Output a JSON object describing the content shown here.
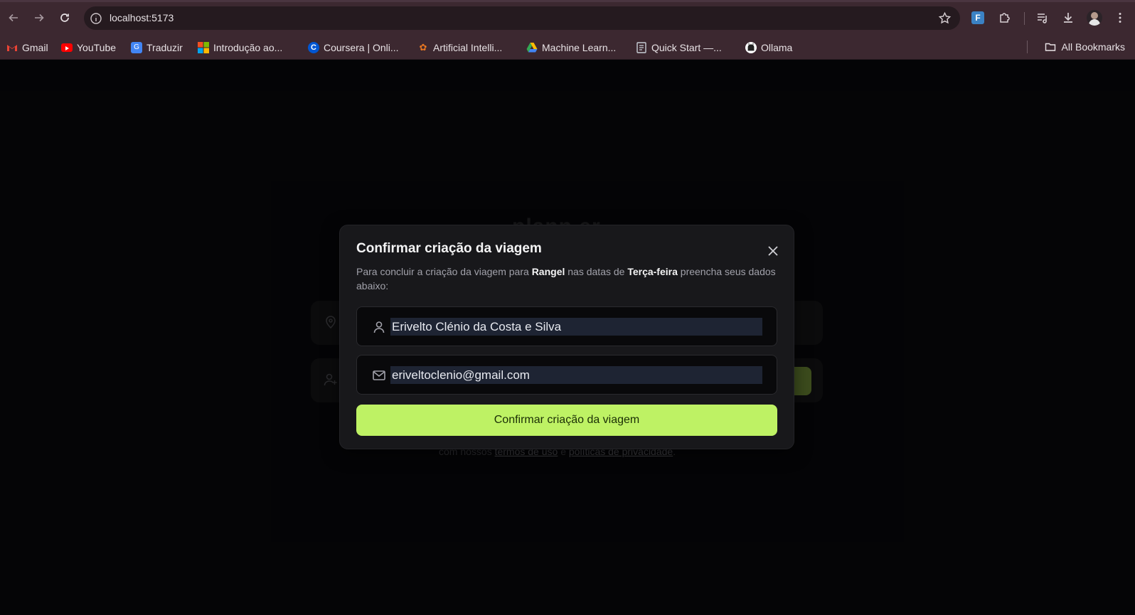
{
  "browser": {
    "url": "localhost:5173",
    "bookmarks": [
      {
        "label": "Gmail",
        "icon": "gmail-icon",
        "color": "#ea4335"
      },
      {
        "label": "YouTube",
        "icon": "youtube-icon",
        "color": "#ff0000"
      },
      {
        "label": "Traduzir",
        "icon": "google-translate-icon",
        "color": "#4285f4"
      },
      {
        "label": "Introdução ao...",
        "icon": "microsoft-icon",
        "color": "#f25022"
      },
      {
        "label": "Coursera | Onli...",
        "icon": "coursera-icon",
        "color": "#0056d2"
      },
      {
        "label": "Artificial Intelli...",
        "icon": "ai-course-icon",
        "color": "#e87722"
      },
      {
        "label": "Machine Learn...",
        "icon": "google-drive-icon",
        "color": "#34a853"
      },
      {
        "label": "Quick Start —...",
        "icon": "docs-icon",
        "color": "#9aa0a6"
      },
      {
        "label": "Ollama",
        "icon": "ollama-icon",
        "color": "#ffffff"
      }
    ],
    "all_bookmarks": "All Bookmarks"
  },
  "background": {
    "logo_text": "plann.er",
    "terms_prefix": "com nossos",
    "terms_link": "termos de uso",
    "terms_and": "e",
    "privacy_link": "políticas de privacidade",
    "terms_suffix": "."
  },
  "modal": {
    "title": "Confirmar criação da viagem",
    "desc_part1": "Para concluir a criação da viagem para",
    "destination": "Rangel",
    "desc_part2": "nas datas de",
    "dates": "Terça-feira",
    "desc_part3": "preencha seus dados abaixo:",
    "name_value": "Erivelto Clénio da Costa e Silva",
    "email_value": "eriveltoclenio@gmail.com",
    "confirm_label": "Confirmar criação da viagem"
  },
  "colors": {
    "accent": "#bef264",
    "modal_bg": "#18181b",
    "page_bg": "#09090b",
    "chrome_bg": "#3c2830"
  }
}
